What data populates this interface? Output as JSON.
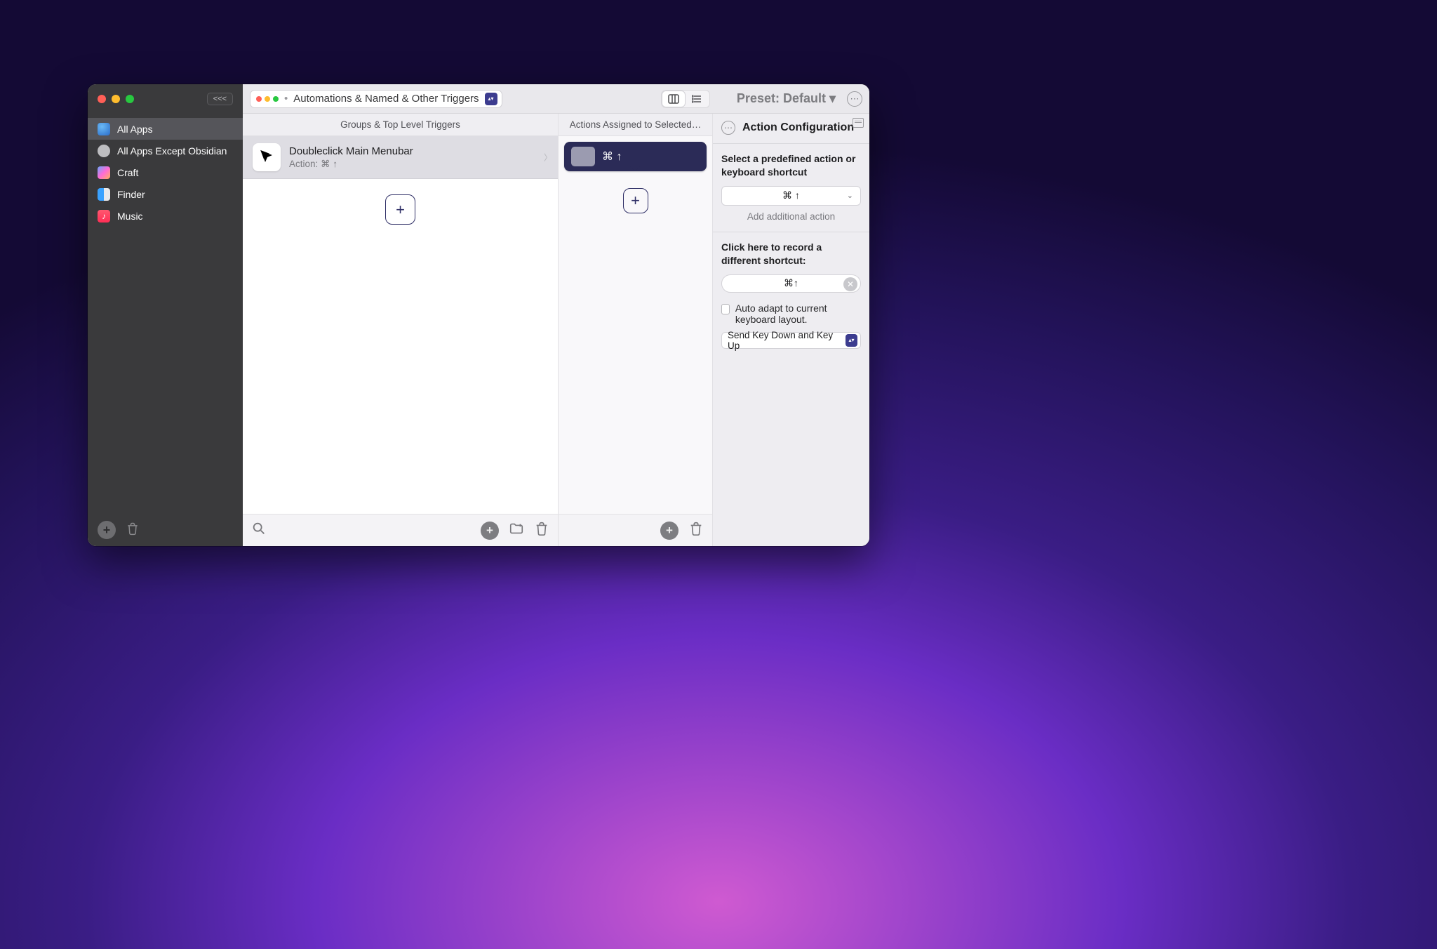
{
  "toolbar": {
    "back_label": "<<<",
    "category_label": "Automations & Named & Other Triggers",
    "preset_label": "Preset: Default ▾"
  },
  "sidebar": {
    "items": [
      {
        "label": "All Apps"
      },
      {
        "label": "All Apps Except Obsidian"
      },
      {
        "label": "Craft"
      },
      {
        "label": "Finder"
      },
      {
        "label": "Music"
      }
    ]
  },
  "groups": {
    "header": "Groups & Top Level Triggers",
    "trigger": {
      "title": "Doubleclick Main Menubar",
      "subtitle": "Action: ⌘ ↑"
    }
  },
  "actions": {
    "header": "Actions Assigned to Selected…",
    "shortcut": "⌘ ↑"
  },
  "config": {
    "title": "Action Configuration",
    "predefined_label": "Select a predefined action or keyboard shortcut",
    "dropdown_value": "⌘ ↑",
    "add_additional": "Add additional action",
    "record_label": "Click here to record a different shortcut:",
    "record_value": "⌘↑",
    "auto_adapt": "Auto adapt to current keyboard layout.",
    "send_mode": "Send Key Down and Key Up"
  }
}
